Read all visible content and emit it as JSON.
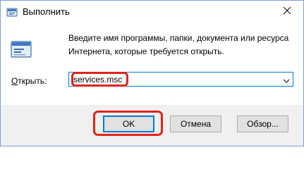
{
  "window": {
    "title": "Выполнить",
    "app_icon": "run-icon",
    "close_icon": "close-icon"
  },
  "main": {
    "icon": "run-icon",
    "description": "Введите имя программы, папки, документа или ресурса Интернета, которые требуется открыть.",
    "open_label_prefix": "О",
    "open_label_rest": "ткрыть:",
    "input_value": "services.msc",
    "dropdown_icon": "chevron-down-icon"
  },
  "buttons": {
    "ok": "OK",
    "cancel": "Отмена",
    "browse": "Обзор..."
  },
  "colors": {
    "highlight": "#e2231a",
    "accent": "#0078d7"
  }
}
